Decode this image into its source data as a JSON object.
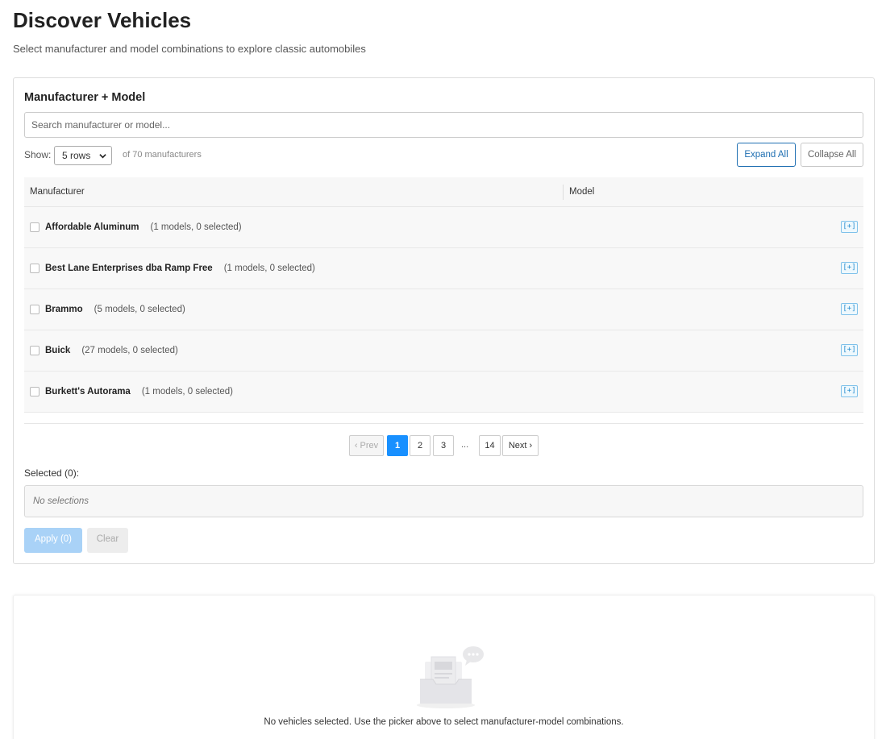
{
  "header": {
    "title": "Discover Vehicles",
    "subtitle": "Select manufacturer and model combinations to explore classic automobiles"
  },
  "picker": {
    "title": "Manufacturer + Model",
    "search_placeholder": "Search manufacturer or model...",
    "show_label": "Show:",
    "rows_selected": "5 rows",
    "count_text": "of 70 manufacturers",
    "expand_all": "Expand All",
    "collapse_all": "Collapse All",
    "columns": [
      "Manufacturer",
      "Model"
    ],
    "rows": [
      {
        "name": "Affordable Aluminum",
        "meta": "(1 models, 0 selected)",
        "toggle": "[+]"
      },
      {
        "name": "Best Lane Enterprises dba Ramp Free",
        "meta": "(1 models, 0 selected)",
        "toggle": "[+]"
      },
      {
        "name": "Brammo",
        "meta": "(5 models, 0 selected)",
        "toggle": "[+]"
      },
      {
        "name": "Buick",
        "meta": "(27 models, 0 selected)",
        "toggle": "[+]"
      },
      {
        "name": "Burkett's Autorama",
        "meta": "(1 models, 0 selected)",
        "toggle": "[+]"
      }
    ],
    "pagination": {
      "prev": "‹ Prev",
      "pages": [
        "1",
        "2",
        "3",
        "14"
      ],
      "ellipsis": "...",
      "next": "Next ›",
      "current": "1"
    },
    "selected_label": "Selected (0):",
    "selected_empty": "No selections",
    "apply_label": "Apply (0)",
    "clear_label": "Clear"
  },
  "results": {
    "empty_message": "No vehicles selected. Use the picker above to select manufacturer-model combinations."
  },
  "colors": {
    "accent": "#1890ff",
    "outline_blue": "#1f6fb2",
    "apply_disabled": "#a9d2f7"
  }
}
